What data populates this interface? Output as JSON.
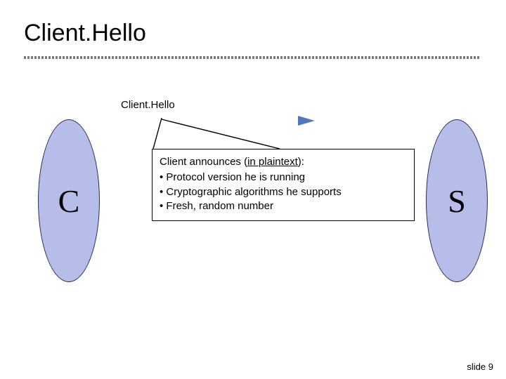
{
  "title": "Client.Hello",
  "message_label": "Client.Hello",
  "client_letter": "C",
  "server_letter": "S",
  "callout": {
    "lead_prefix": "Client announces (",
    "lead_underlined": "in plaintext",
    "lead_suffix": "):",
    "bullets": [
      "Protocol version he is running",
      "Cryptographic algorithms he supports",
      "Fresh, random number"
    ]
  },
  "footer_label": "slide",
  "footer_number": "9",
  "colors": {
    "ellipse_fill": "#b6bde8",
    "ellipse_stroke": "#2a2a60",
    "arrow": "#355fb1"
  }
}
